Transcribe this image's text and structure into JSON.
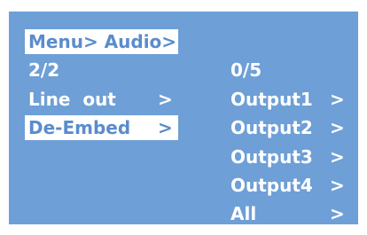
{
  "colors": {
    "panel_background": "#6e9fd6",
    "text": "#ffffff",
    "selection_background": "#ffffff",
    "selection_text": "#5b8ccc"
  },
  "breadcrumb": {
    "text": "Menu> Audio>"
  },
  "left_menu": {
    "page_indicator": "2/2",
    "items": [
      {
        "label": "Line  out",
        "arrow": ">",
        "selected": false
      },
      {
        "label": "De-Embed",
        "arrow": ">",
        "selected": true
      }
    ]
  },
  "right_menu": {
    "page_indicator": "0/5",
    "items": [
      {
        "label": "Output1",
        "arrow": ">"
      },
      {
        "label": "Output2",
        "arrow": ">"
      },
      {
        "label": "Output3",
        "arrow": ">"
      },
      {
        "label": "Output4",
        "arrow": ">"
      },
      {
        "label": "All",
        "arrow": ">"
      }
    ]
  }
}
